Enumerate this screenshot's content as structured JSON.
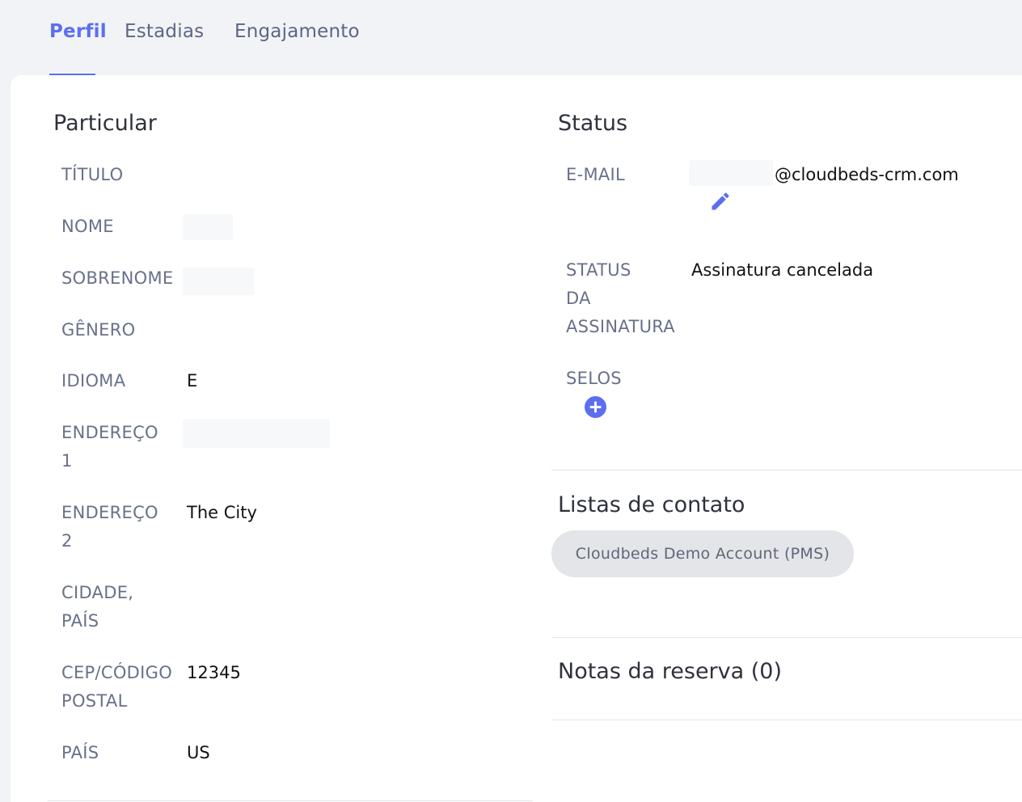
{
  "tabs": [
    {
      "label": "Perfil",
      "active": true
    },
    {
      "label": "Estadias",
      "active": false
    },
    {
      "label": "Engajamento",
      "active": false
    }
  ],
  "particular": {
    "title": "Particular",
    "fields": {
      "titulo": {
        "label": "TÍTULO",
        "value": ""
      },
      "nome": {
        "label": "NOME",
        "value": ""
      },
      "sobrenome": {
        "label": "SOBRENOME",
        "value": ""
      },
      "genero": {
        "label": "GÊNERO",
        "value": ""
      },
      "idioma": {
        "label": "IDIOMA",
        "value": "E"
      },
      "endereco1": {
        "label_line1": "ENDEREÇO",
        "label_line2": "1",
        "value": ""
      },
      "endereco2": {
        "label_line1": "ENDEREÇO",
        "label_line2": "2",
        "value": "The City"
      },
      "cidade": {
        "label_line1": "CIDADE,",
        "label_line2": "PAÍS",
        "value": ""
      },
      "cep": {
        "label_line1": "CEP/CÓDIGO",
        "label_line2": "POSTAL",
        "value": "12345"
      },
      "pais": {
        "label": "PAÍS",
        "value": "US"
      }
    }
  },
  "status": {
    "title": "Status",
    "email": {
      "label": "E-MAIL",
      "value": "@cloudbeds-crm.com"
    },
    "subscription": {
      "label_line1": "STATUS",
      "label_line2": "DA",
      "label_line3": "ASSINATURA",
      "value": "Assinatura cancelada"
    },
    "badges": {
      "label": "SELOS"
    }
  },
  "contact_lists": {
    "title": "Listas de contato",
    "items": [
      "Cloudbeds Demo Account (PMS)"
    ]
  },
  "booking_notes": {
    "title": "Notas da reserva (0)"
  },
  "colors": {
    "accent": "#5b6ff0",
    "label": "#69708a",
    "chip_bg": "#e4e5e8"
  }
}
